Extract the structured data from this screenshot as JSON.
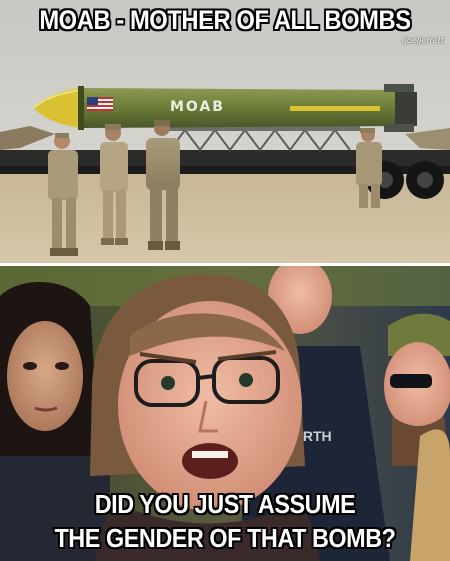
{
  "meme": {
    "top_caption": "MOAB - MOTHER OF ALL BOMBS",
    "credit": "/joeljerrett",
    "bomb_marking": "MOAB",
    "shirt_text": "ORTH",
    "bottom_caption_line1": "DID YOU JUST ASSUME",
    "bottom_caption_line2": "THE GENDER OF THAT BOMB?"
  },
  "colors": {
    "bomb_body": "#6f7f3a",
    "bomb_nose": "#d8c233",
    "desert_sand": "#c9b89a",
    "sky": "#d9d7d2",
    "caption_text": "#ffffff",
    "caption_outline": "#000000"
  }
}
